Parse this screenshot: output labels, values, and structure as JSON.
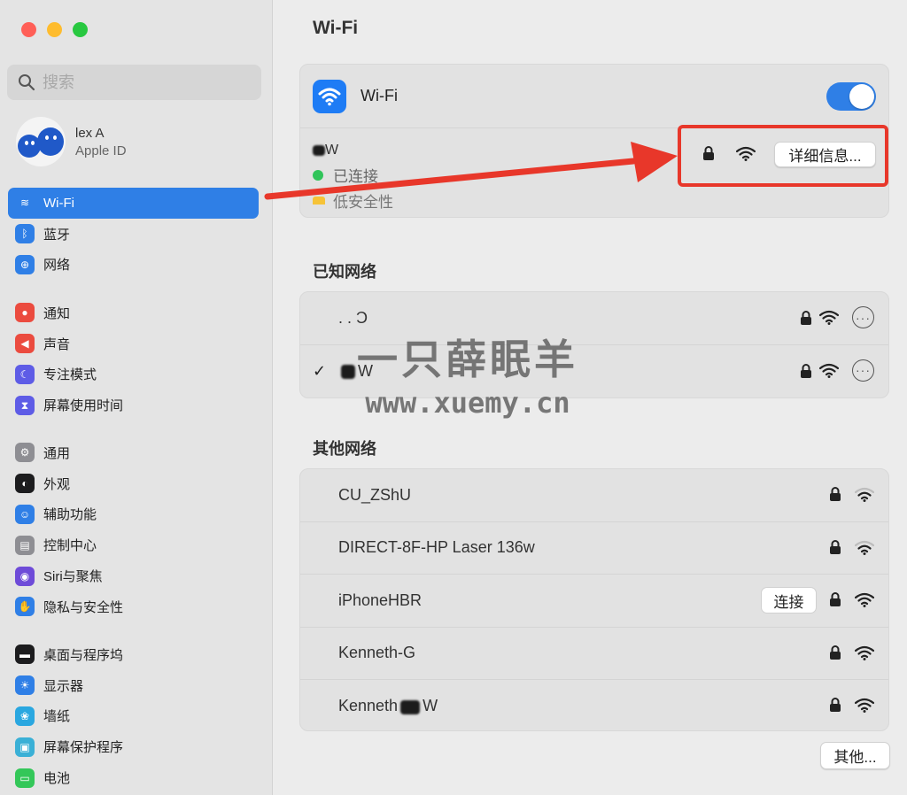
{
  "window": {
    "title": "Wi-Fi"
  },
  "sidebar": {
    "search_placeholder": "搜索",
    "account": {
      "name": "lex A",
      "subtitle": "Apple ID"
    },
    "groups": [
      [
        {
          "label": "Wi-Fi",
          "icon": "wifi-icon",
          "color": "#2f7fe6",
          "active": true
        },
        {
          "label": "蓝牙",
          "icon": "bluetooth-icon",
          "color": "#2f7fe6"
        },
        {
          "label": "网络",
          "icon": "globe-icon",
          "color": "#2f7fe6"
        }
      ],
      [
        {
          "label": "通知",
          "icon": "bell-icon",
          "color": "#eb4b3f"
        },
        {
          "label": "声音",
          "icon": "speaker-icon",
          "color": "#eb4b3f"
        },
        {
          "label": "专注模式",
          "icon": "moon-icon",
          "color": "#5e5ce6"
        },
        {
          "label": "屏幕使用时间",
          "icon": "hourglass-icon",
          "color": "#5e5ce6"
        }
      ],
      [
        {
          "label": "通用",
          "icon": "gear-icon",
          "color": "#8e8e93"
        },
        {
          "label": "外观",
          "icon": "appearance-icon",
          "color": "#1c1c1e"
        },
        {
          "label": "辅助功能",
          "icon": "accessibility-icon",
          "color": "#2f7fe6"
        },
        {
          "label": "控制中心",
          "icon": "control-center-icon",
          "color": "#8e8e93"
        },
        {
          "label": "Siri与聚焦",
          "icon": "siri-icon",
          "color": "#6e4bd8"
        },
        {
          "label": "隐私与安全性",
          "icon": "hand-icon",
          "color": "#2f7fe6"
        }
      ],
      [
        {
          "label": "桌面与程序坞",
          "icon": "dock-icon",
          "color": "#1c1c1e"
        },
        {
          "label": "显示器",
          "icon": "sun-icon",
          "color": "#2f7fe6"
        },
        {
          "label": "墙纸",
          "icon": "flower-icon",
          "color": "#2aa7e0"
        },
        {
          "label": "屏幕保护程序",
          "icon": "screensaver-icon",
          "color": "#3ab0d6"
        },
        {
          "label": "电池",
          "icon": "battery-icon",
          "color": "#34c759"
        }
      ]
    ]
  },
  "main": {
    "title": "Wi-Fi",
    "wifi_label": "Wi-Fi",
    "wifi_enabled": true,
    "current": {
      "name_suffix": "W",
      "status": "已连接",
      "security": "低安全性",
      "details_button": "详细信息..."
    },
    "known_title": "已知网络",
    "known_networks": [
      {
        "name": ". . Ͻ",
        "checked": false,
        "check": ""
      },
      {
        "name": "W",
        "checked": true,
        "check": "✓"
      }
    ],
    "other_title": "其他网络",
    "other_networks": [
      {
        "name": "CU_ZShU",
        "connect": "",
        "signal": "medium"
      },
      {
        "name": "DIRECT-8F-HP Laser 136w",
        "connect": "",
        "signal": "medium"
      },
      {
        "name": "iPhoneHBR",
        "connect": "连接",
        "signal": "full"
      },
      {
        "name": "Kenneth-G",
        "connect": "",
        "signal": "full"
      },
      {
        "name_prefix": "Kenneth",
        "name_suffix": "W",
        "connect": "",
        "signal": "full"
      }
    ],
    "other_button": "其他..."
  },
  "watermark": {
    "line1": "一只薛眠羊",
    "line2": "www.xuemy.cn"
  },
  "annotation": {
    "color": "#e8372a"
  }
}
